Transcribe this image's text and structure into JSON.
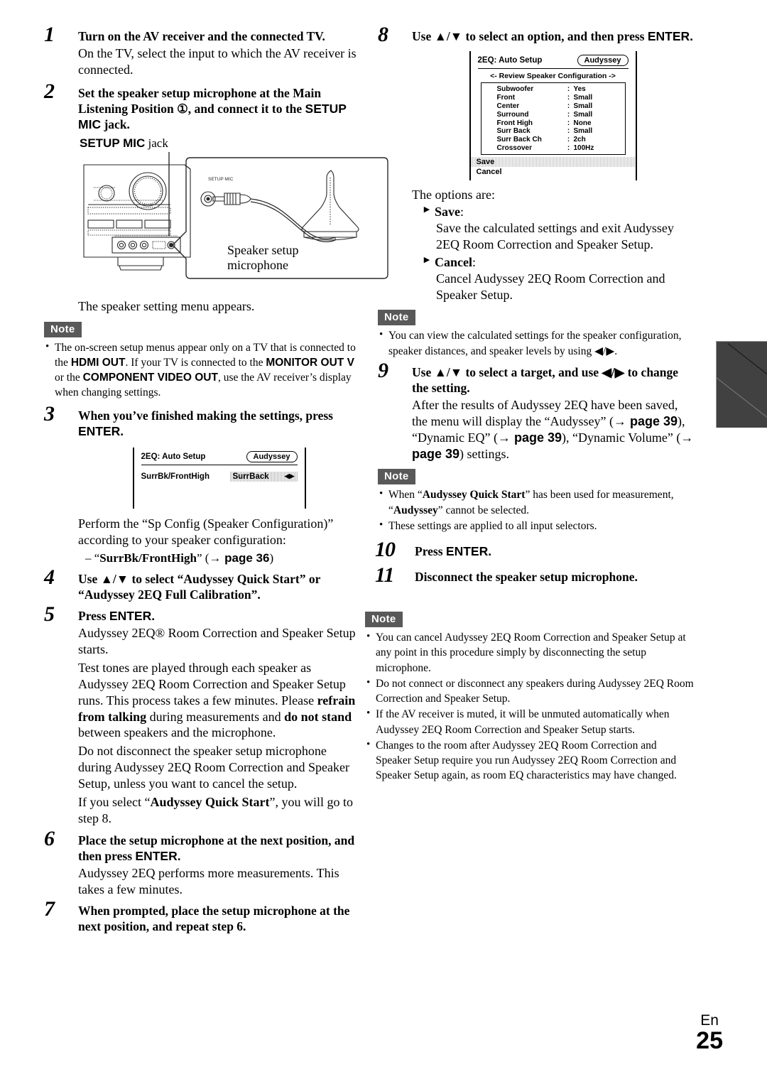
{
  "document": {
    "footer_language": "En",
    "page_number": "25"
  },
  "left_column": {
    "step1": {
      "number": "1",
      "heading": "Turn on the AV receiver and the connected TV.",
      "body": "On the TV, select the input to which the AV receiver is connected."
    },
    "step2": {
      "number": "2",
      "heading_part1": "Set the speaker setup microphone at the Main Listening Position ",
      "heading_circle": "①",
      "heading_part2": ", and connect it to the ",
      "heading_bold_sans": "SETUP MIC",
      "heading_part3": " jack.",
      "jack_label_bold": "SETUP MIC",
      "jack_label_rest": " jack",
      "diagram_caption": "Speaker setup microphone",
      "diagram_port_label": "SETUP MIC",
      "after_body": "The speaker setting menu appears."
    },
    "note1": {
      "badge": "Note",
      "bullets": [
        {
          "segments": [
            {
              "t": "The on-screen setup menus appear only on a TV that is connected to the ",
              "s": "normal"
            },
            {
              "t": "HDMI OUT",
              "s": "sans-bold"
            },
            {
              "t": ". If your TV is connected to the ",
              "s": "normal"
            },
            {
              "t": "MONITOR OUT V",
              "s": "sans-bold"
            },
            {
              "t": " or the ",
              "s": "normal"
            },
            {
              "t": "COMPONENT VIDEO OUT",
              "s": "sans-bold"
            },
            {
              "t": ", use the AV receiver’s display when changing settings.",
              "s": "normal"
            }
          ]
        }
      ]
    },
    "step3": {
      "number": "3",
      "heading_part1": "When you’ve finished making the settings, press ",
      "heading_bold_sans": "ENTER.",
      "osd": {
        "title": "2EQ: Auto Setup",
        "badge": "Audyssey",
        "row_label": "SurrBk/FrontHigh",
        "row_value": "SurrBack",
        "row_arrows": "◀▶"
      },
      "body1": "Perform the “Sp Config (Speaker Configuration)” according to your speaker configuration:",
      "body2_dash": "– “",
      "body2_bold": "SurrBk/FrontHigh",
      "body2_mid": "” (",
      "body2_arrow": "→ ",
      "body2_page": "page 36",
      "body2_end": ")"
    },
    "step4": {
      "number": "4",
      "heading": "Use ▲/▼ to select “Audyssey Quick Start” or “Audyssey 2EQ Full Calibration”."
    },
    "step5": {
      "number": "5",
      "heading_part1": "Press ",
      "heading_bold_sans": "ENTER.",
      "body1": "Audyssey 2EQ® Room Correction and Speaker Setup starts.",
      "body2_a": "Test tones are played through each speaker as Audyssey 2EQ Room Correction and Speaker Setup runs. This process takes a few minutes. Please ",
      "body2_b": "refrain from talking",
      "body2_c": " during measurements and ",
      "body2_d": "do not stand",
      "body2_e": " between speakers and the microphone.",
      "body3": "Do not disconnect the speaker setup microphone during Audyssey 2EQ Room Correction and Speaker Setup, unless you want to cancel the setup.",
      "body4_a": "If you select “",
      "body4_b": "Audyssey Quick Start",
      "body4_c": "”, you will go to step 8."
    },
    "step6": {
      "number": "6",
      "heading_part1": "Place the setup microphone at the next position, and then press ",
      "heading_bold_sans": "ENTER.",
      "body": "Audyssey 2EQ performs more measurements. This takes a few minutes."
    },
    "step7": {
      "number": "7",
      "heading": "When prompted, place the setup microphone at the next position, and repeat step 6."
    }
  },
  "right_column": {
    "step8": {
      "number": "8",
      "heading_part1": "Use ▲/▼ to select an option, and then press ",
      "heading_bold_sans": "ENTER.",
      "osd": {
        "title": "2EQ: Auto Setup",
        "badge": "Audyssey",
        "subtitle": "<- Review Speaker Configuration ->",
        "rows": [
          {
            "name": "Subwoofer",
            "colon": ":",
            "value": "Yes"
          },
          {
            "name": "Front",
            "colon": ":",
            "value": "Small"
          },
          {
            "name": "Center",
            "colon": ":",
            "value": "Small"
          },
          {
            "name": "Surround",
            "colon": ":",
            "value": "Small"
          },
          {
            "name": "Front High",
            "colon": ":",
            "value": "None"
          },
          {
            "name": "Surr Back",
            "colon": ":",
            "value": "Small"
          },
          {
            "name": "Surr Back Ch",
            "colon": ":",
            "value": "2ch"
          },
          {
            "name": "Crossover",
            "colon": ":",
            "value": "100Hz"
          }
        ],
        "save_label": "Save",
        "cancel_label": "Cancel"
      },
      "options_intro": "The options are:",
      "option_save_label": "Save",
      "option_save_colon": ":",
      "option_save_body": "Save the calculated settings and exit Audyssey 2EQ Room Correction and Speaker Setup.",
      "option_cancel_label": "Cancel",
      "option_cancel_colon": ":",
      "option_cancel_body": "Cancel Audyssey 2EQ Room Correction and Speaker Setup."
    },
    "note2": {
      "badge": "Note",
      "bullet": "You can view the calculated settings for the speaker configuration, speaker distances, and speaker levels by using ◀/▶."
    },
    "step9": {
      "number": "9",
      "heading": "Use ▲/▼ to select a target, and use ◀/▶ to change the setting.",
      "body_a": "After the results of Audyssey 2EQ have been saved, the menu will display the “Audyssey” (",
      "body_arrow": "→ ",
      "body_page": "page 39",
      "body_b": "), “Dynamic EQ” (",
      "body_c": "), “Dynamic Volume” (",
      "body_d": ") settings."
    },
    "note3": {
      "badge": "Note",
      "bullets": [
        {
          "segments": [
            {
              "t": "When “",
              "s": "normal"
            },
            {
              "t": "Audyssey Quick Start",
              "s": "bold"
            },
            {
              "t": "” has been used for measurement, “",
              "s": "normal"
            },
            {
              "t": "Audyssey",
              "s": "bold"
            },
            {
              "t": "” cannot be selected.",
              "s": "normal"
            }
          ]
        },
        {
          "segments": [
            {
              "t": "These settings are applied to all input selectors.",
              "s": "normal"
            }
          ]
        }
      ]
    },
    "step10": {
      "number": "10",
      "heading_part1": "Press ",
      "heading_bold_sans": "ENTER."
    },
    "step11": {
      "number": "11",
      "heading": "Disconnect the speaker setup microphone."
    },
    "note4": {
      "badge": "Note",
      "bullets": [
        {
          "segments": [
            {
              "t": "You can cancel Audyssey 2EQ Room Correction and Speaker Setup at any point in this procedure simply by disconnecting the setup microphone.",
              "s": "normal"
            }
          ]
        },
        {
          "segments": [
            {
              "t": "Do not connect or disconnect any speakers during Audyssey 2EQ Room Correction and Speaker Setup.",
              "s": "normal"
            }
          ]
        },
        {
          "segments": [
            {
              "t": "If the AV receiver is muted, it will be unmuted automatically when Audyssey 2EQ Room Correction and Speaker Setup starts.",
              "s": "normal"
            }
          ]
        },
        {
          "segments": [
            {
              "t": "Changes to the room after Audyssey 2EQ Room Correction and Speaker Setup require you run Audyssey 2EQ Room Correction and Speaker Setup again, as room EQ characteristics may have changed.",
              "s": "normal"
            }
          ]
        }
      ]
    }
  }
}
